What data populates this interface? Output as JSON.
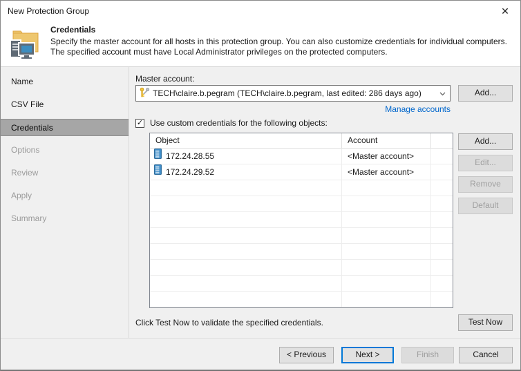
{
  "window": {
    "title": "New Protection Group"
  },
  "icons": {
    "close": "✕",
    "check": "✓",
    "chevron": "⌄",
    "header": "folder-computer-icon",
    "account": "keys-icon",
    "row": "server-icon"
  },
  "header": {
    "title": "Credentials",
    "line1": "Specify the master account for all hosts in this protection group. You can also customize credentials for individual computers.",
    "line2": "The specified account must have Local Administrator privileges on the protected computers."
  },
  "sidebar": {
    "items": [
      {
        "label": "Name",
        "state": "done"
      },
      {
        "label": "CSV File",
        "state": "done"
      },
      {
        "label": "Credentials",
        "state": "active"
      },
      {
        "label": "Options",
        "state": "upcoming"
      },
      {
        "label": "Review",
        "state": "upcoming"
      },
      {
        "label": "Apply",
        "state": "upcoming"
      },
      {
        "label": "Summary",
        "state": "upcoming"
      }
    ]
  },
  "master": {
    "label": "Master account:",
    "selected": "TECH\\claire.b.pegram (TECH\\claire.b.pegram, last edited: 286 days ago)",
    "add": "Add...",
    "manage": "Manage accounts"
  },
  "custom": {
    "checkbox": "Use custom credentials for the following objects:",
    "checked": true,
    "columns": [
      "Object",
      "Account"
    ],
    "rows": [
      {
        "object": "172.24.28.55",
        "account": "<Master account>"
      },
      {
        "object": "172.24.29.52",
        "account": "<Master account>"
      }
    ],
    "buttons": {
      "add": "Add...",
      "edit": "Edit...",
      "remove": "Remove",
      "default": "Default"
    }
  },
  "test": {
    "hint": "Click Test Now to validate the specified credentials.",
    "button": "Test Now"
  },
  "footer": {
    "previous": "< Previous",
    "next": "Next >",
    "finish": "Finish",
    "cancel": "Cancel"
  },
  "colors": {
    "accent": "#0078d7",
    "link": "#0066cc",
    "selected_step_bg": "#a6a6a6",
    "header_bg": "#ffffff",
    "window_bg": "#f0f0f0"
  }
}
